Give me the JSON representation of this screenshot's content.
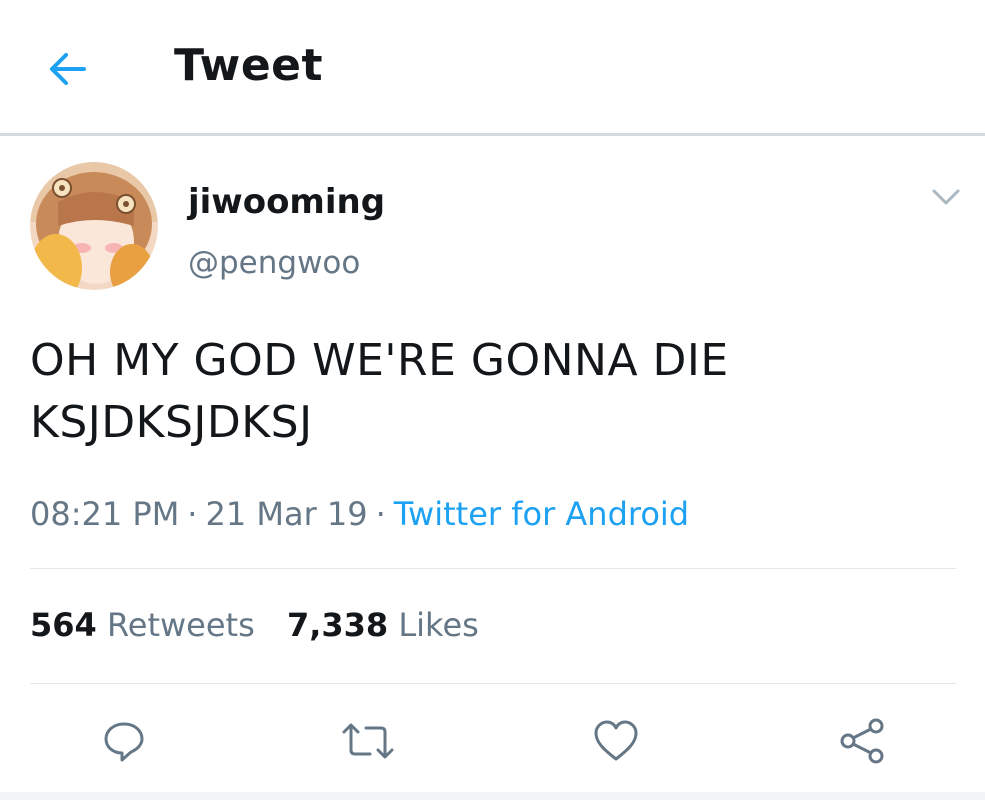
{
  "header": {
    "title": "Tweet",
    "back_icon": "arrow-left-icon",
    "accent_color": "#1da1f2"
  },
  "tweet": {
    "author": {
      "display_name": "jiwooming",
      "handle": "@pengwoo"
    },
    "text_lines": [
      "OH MY GOD WE'RE GONNA DIE",
      "KSJDKSJDKSJ"
    ],
    "time": "08:21 PM",
    "separator": "·",
    "date": "21 Mar 19",
    "source": "Twitter for Android",
    "stats": {
      "retweets_count": "564",
      "retweets_label": "Retweets",
      "likes_count": "7,338",
      "likes_label": "Likes"
    }
  },
  "actions": {
    "reply_icon": "reply-icon",
    "retweet_icon": "retweet-icon",
    "like_icon": "heart-icon",
    "share_icon": "share-icon"
  }
}
